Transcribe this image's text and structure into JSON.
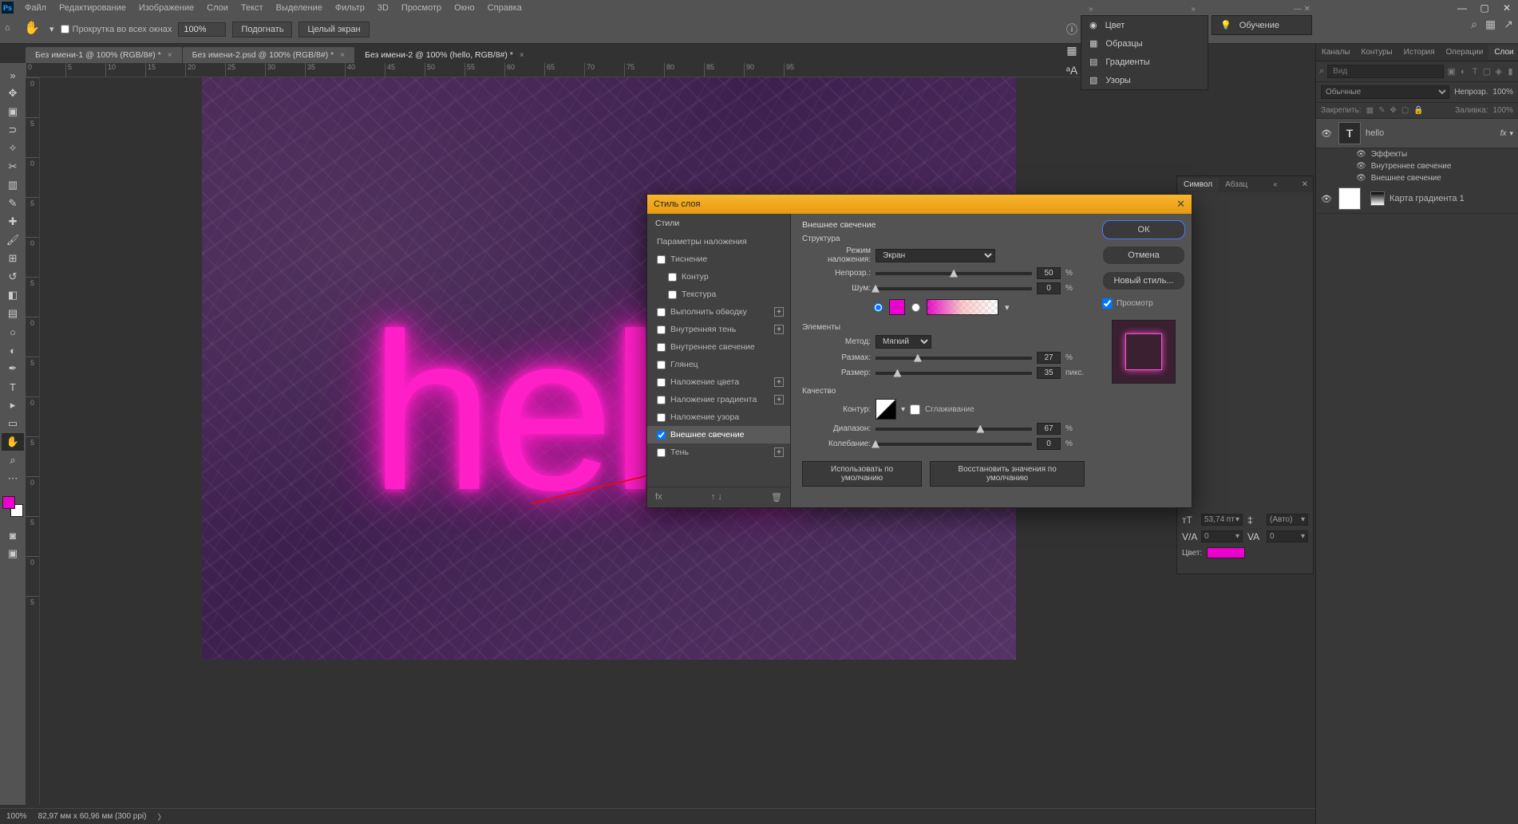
{
  "menu": [
    "Файл",
    "Редактирование",
    "Изображение",
    "Слои",
    "Текст",
    "Выделение",
    "Фильтр",
    "3D",
    "Просмотр",
    "Окно",
    "Справка"
  ],
  "options": {
    "scroll_all_windows": "Прокрутка во всех окнах",
    "zoom": "100%",
    "fit_screen": "Подогнать",
    "full_screen": "Целый экран"
  },
  "doc_tabs": {
    "t1": "Без имени-1 @ 100% (RGB/8#) *",
    "t2": "Без имени-2.psd @ 100% (RGB/8#) *",
    "t3": "Без имени-2 @ 100% (hello, RGB/8#) *"
  },
  "canvas_text": "hello",
  "ruler_h": [
    "0",
    "5",
    "10",
    "15",
    "20",
    "25",
    "30",
    "35",
    "40",
    "45",
    "50",
    "55",
    "60",
    "65",
    "70",
    "75",
    "80",
    "85",
    "90",
    "95"
  ],
  "ruler_v": [
    "0",
    "5",
    "0",
    "5",
    "0",
    "5",
    "0",
    "5",
    "0",
    "5",
    "0",
    "5",
    "0",
    "5"
  ],
  "status": {
    "zoom": "100%",
    "doc_info": "82,97 мм x 60,96 мм (300 ppi)"
  },
  "quick_panels": {
    "color": "Цвет",
    "swatches": "Образцы",
    "gradients": "Градиенты",
    "patterns": "Узоры"
  },
  "learn_panel": {
    "learn": "Обучение"
  },
  "layers_panel": {
    "tabs": {
      "channels": "Каналы",
      "paths": "Контуры",
      "history": "История",
      "actions": "Операции",
      "layers": "Слои"
    },
    "search_placeholder": "Вид",
    "blend_mode": "Обычные",
    "opacity_label": "Непрозр.",
    "opacity": "100%",
    "lock_label": "Закрепить:",
    "fill_label": "Заливка:",
    "fill": "100%",
    "layers": {
      "l0": {
        "name": "hello"
      },
      "effects_label": "Эффекты",
      "eff1": "Внутреннее свечение",
      "eff2": "Внешнее свечение",
      "l1": {
        "name": "Карта градиента 1"
      }
    }
  },
  "char_panel": {
    "tabs": {
      "character": "Символ",
      "paragraph": "Абзац"
    },
    "size": "53,74 пт",
    "leading": "(Авто)",
    "va": "0",
    "tracking": "0",
    "color_label": "Цвет:"
  },
  "dialog": {
    "title": "Стиль слоя",
    "styles_header": "Стили",
    "blending_options": "Параметры наложения",
    "items": {
      "bevel": "Тиснение",
      "contour": "Контур",
      "texture": "Текстура",
      "stroke": "Выполнить обводку",
      "inner_shadow": "Внутренняя тень",
      "inner_glow": "Внутреннее свечение",
      "satin": "Глянец",
      "color_overlay": "Наложение цвета",
      "gradient_overlay": "Наложение градиента",
      "pattern_overlay": "Наложение узора",
      "outer_glow": "Внешнее свечение",
      "drop_shadow": "Тень"
    },
    "settings": {
      "title": "Внешнее свечение",
      "structure": "Структура",
      "blend_mode_label": "Режим наложения:",
      "blend_mode": "Экран",
      "opacity_label": "Непрозр.:",
      "opacity": "50",
      "noise_label": "Шум:",
      "noise": "0",
      "elements": "Элементы",
      "technique_label": "Метод:",
      "technique": "Мягкий",
      "spread_label": "Размах:",
      "spread": "27",
      "size_label": "Размер:",
      "size": "35",
      "size_unit": "пикс.",
      "quality": "Качество",
      "contour_label": "Контур:",
      "anti_alias": "Сглаживание",
      "range_label": "Диапазон:",
      "range": "67",
      "jitter_label": "Колебание:",
      "jitter": "0",
      "reset_default": "Использовать по умолчанию",
      "restore_default": "Восстановить значения по умолчанию",
      "percent": "%"
    },
    "buttons": {
      "ok": "ОК",
      "cancel": "Отмена",
      "new_style": "Новый стиль...",
      "preview": "Просмотр"
    }
  }
}
